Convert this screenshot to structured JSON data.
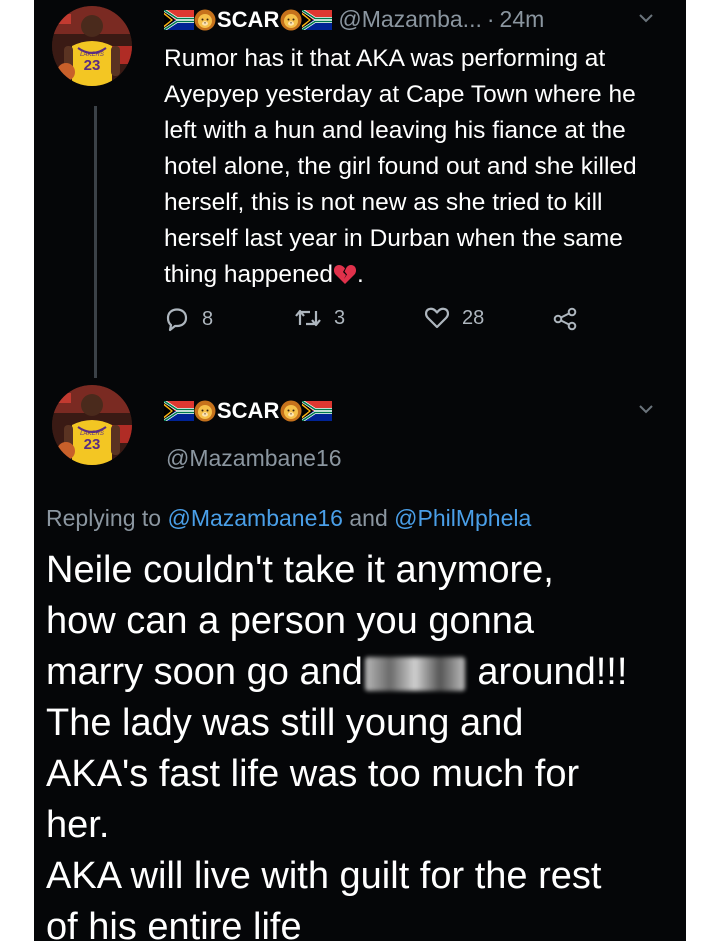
{
  "tweet1": {
    "display_name": "SCAR",
    "handle": "@Mazamba...",
    "separator": "·",
    "time": "24m",
    "text_before_emoji": "Rumor has it that AKA was performing at Ayepyep yesterday at Cape Town where he left with a hun and leaving his fiance at the hotel alone, the girl found out and she killed herself, this is not new as she tried to kill herself last year in Durban when the same thing happened",
    "text_after_emoji": ".",
    "reply_count": "8",
    "retweet_count": "3",
    "like_count": "28",
    "jersey_number": "23"
  },
  "tweet2": {
    "display_name": "SCAR",
    "handle": "@Mazambane16",
    "replying_prefix": "Replying to",
    "reply_user1": "@Mazambane16",
    "reply_and": "and",
    "reply_user2": "@PhilMphela",
    "line1": "Neile couldn't take it anymore,",
    "line2": "how can a person you gonna",
    "line3a": "marry soon go and",
    "line3b": "around!!!",
    "line4": "The lady was still young and",
    "line5": "AKA's fast life was too much for",
    "line6": "her.",
    "line7": "AKA will live with guilt for the rest",
    "line8": "of his entire life",
    "jersey_number": "23"
  },
  "icons": {
    "flag": "south-africa-flag-icon",
    "lion": "lion-face-icon",
    "reply": "reply-icon",
    "retweet": "retweet-icon",
    "like": "heart-icon",
    "share": "share-icon",
    "broken_heart": "broken-heart-icon",
    "chevron": "chevron-down-icon"
  },
  "colors": {
    "background": "#050608",
    "link": "#4a9fe8",
    "secondary_text": "#8b96a0",
    "broken_heart": "#e0314b",
    "jersey": "#f3c623"
  }
}
